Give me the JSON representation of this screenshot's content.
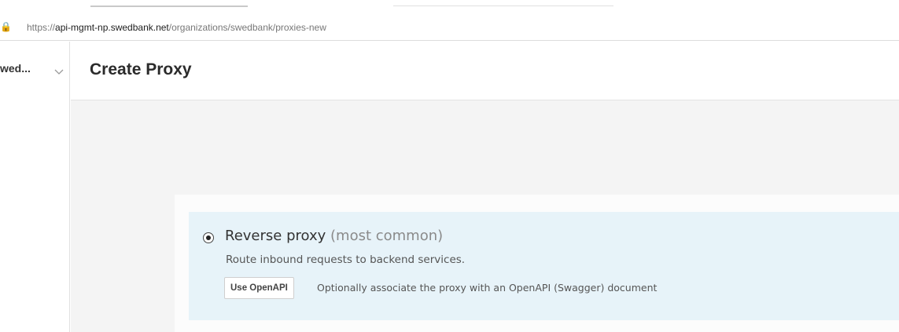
{
  "browser": {
    "url_protocol": "https://",
    "url_host": "api-mgmt-np.swedbank.net",
    "url_path": "/organizations/swedbank/proxies-new"
  },
  "sidebar": {
    "org_name": "wed..."
  },
  "header": {
    "title": "Create Proxy"
  },
  "options": [
    {
      "title": "Reverse proxy",
      "title_note": "(most common)",
      "selected": true,
      "description": "Route inbound requests to backend services.",
      "action_label": "Use OpenAPI",
      "action_description": "Optionally associate the proxy with an OpenAPI (Swagger) document"
    }
  ]
}
